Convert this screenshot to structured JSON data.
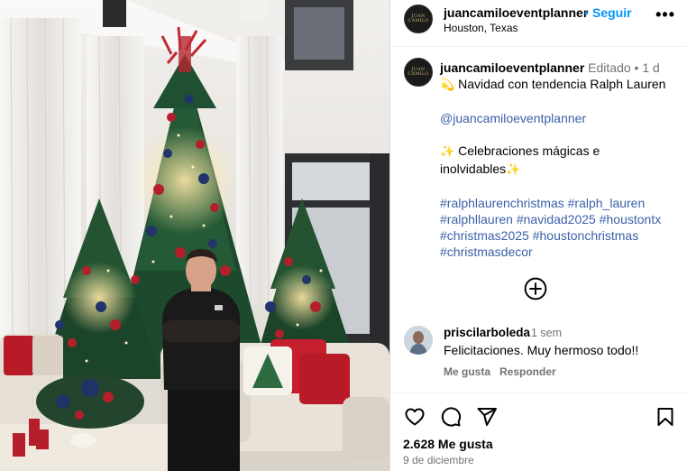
{
  "header": {
    "avatar_text": "JUAN CAMILO",
    "username": "juancamiloeventplanner",
    "separator": "•",
    "follow_label": "Seguir",
    "location": "Houston, Texas",
    "more_label": "•••"
  },
  "caption": {
    "avatar_text": "JUAN CAMILO",
    "username": "juancamiloeventplanner",
    "edited_label": "Editado",
    "separator": "•",
    "time_ago": "1 d",
    "line1_emoji": "💫",
    "line1_text": "Navidad con tendencia Ralph Lauren",
    "mention": "@juancamiloeventplanner",
    "line3_emoji": "✨",
    "line3_text": "Celebraciones mágicas e",
    "line4_text": "inolvidables",
    "line4_emoji": "✨",
    "hashtags": [
      "#ralphlaurenchristmas",
      "#ralph_lauren",
      "#ralphllauren",
      "#navidad2025",
      "#houstontx",
      "#christmas2025",
      "#houstonchristmas",
      "#christmasdecor"
    ]
  },
  "load_more_icon": "plus-circle-icon",
  "comment": {
    "username": "priscilarboleda",
    "time_ago": "1 sem",
    "text": "Felicitaciones. Muy hermoso todo!!",
    "like_label": "Me gusta",
    "reply_label": "Responder"
  },
  "actions": {
    "like_icon": "heart-icon",
    "comment_icon": "comment-icon",
    "share_icon": "share-icon",
    "save_icon": "bookmark-icon"
  },
  "likes_count": "2.628 Me gusta",
  "date": "9 de diciembre",
  "colors": {
    "accent_blue": "#0095f6",
    "link_blue": "#3b61a8",
    "secondary_text": "#737373"
  }
}
